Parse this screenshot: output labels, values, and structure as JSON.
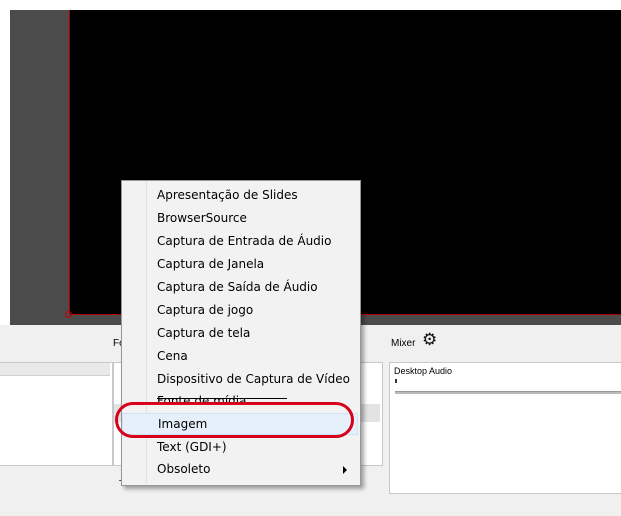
{
  "colors": {
    "preview_border": "#b00000",
    "annotation": "#d8001b",
    "menu_highlight": "#e5f0fb"
  },
  "docks": {
    "sources": {
      "title": "Fo"
    },
    "mixer": {
      "title": "Mixer",
      "settings_icon": "gear-icon",
      "channels": [
        {
          "label": "Desktop Audio"
        }
      ]
    }
  },
  "context_menu": {
    "items": [
      {
        "label": "Apresentação de Slides"
      },
      {
        "label": "BrowserSource"
      },
      {
        "label": "Captura de Entrada de Áudio"
      },
      {
        "label": "Captura de Janela"
      },
      {
        "label": "Captura de Saída de Áudio"
      },
      {
        "label": "Captura de jogo"
      },
      {
        "label": "Captura de tela"
      },
      {
        "label": "Cena"
      },
      {
        "label": "Dispositivo de Captura de Vídeo"
      },
      {
        "label": "Fonte de mídia"
      },
      {
        "label": "Imagem"
      },
      {
        "label": "Text (GDI+)"
      },
      {
        "label": "Obsoleto",
        "has_submenu": true
      }
    ]
  }
}
